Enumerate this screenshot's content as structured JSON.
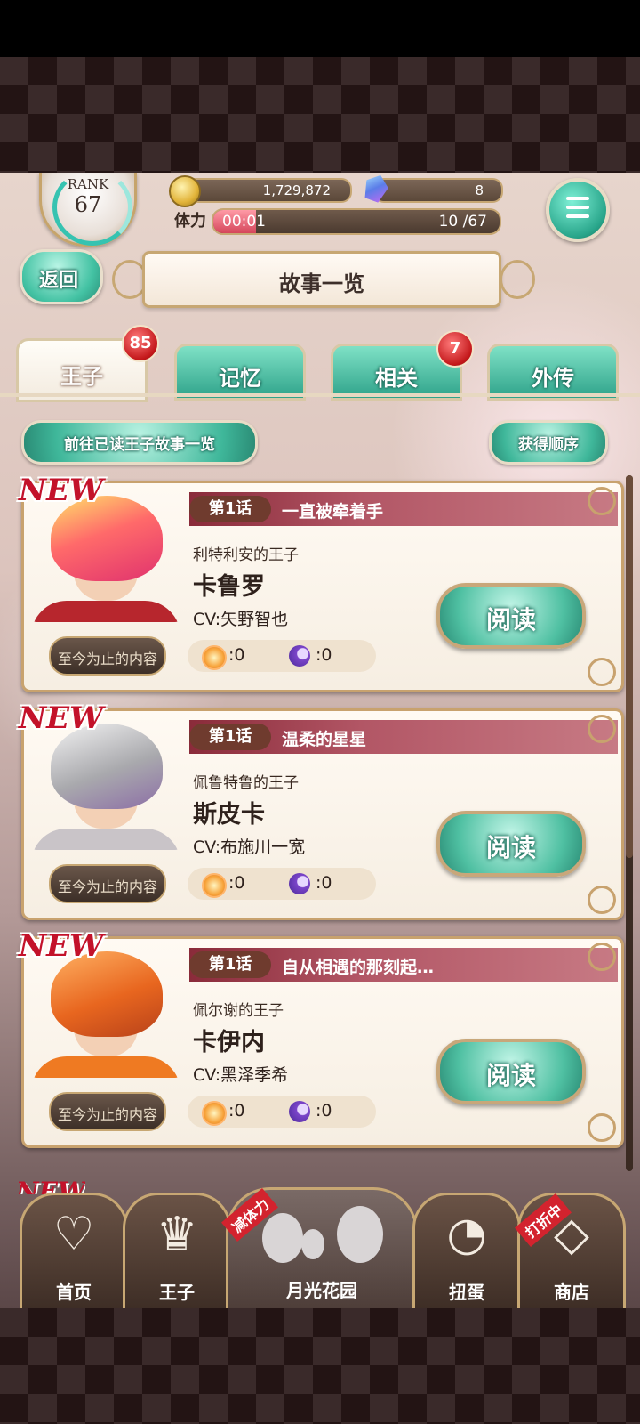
{
  "header": {
    "rank_label": "RANK",
    "rank_value": "67",
    "coins": "1,729,872",
    "gems": "8",
    "stamina_label": "体力",
    "stamina_timer": "00:01",
    "stamina_count": "10 /67",
    "stamina_fraction": 0.15,
    "menu_icon": "hamburger-icon"
  },
  "nav": {
    "back_label": "返回",
    "page_title": "故事一览"
  },
  "tabs": [
    {
      "label": "王子",
      "badge": "85",
      "active": true
    },
    {
      "label": "记忆",
      "badge": "",
      "active": false
    },
    {
      "label": "相关",
      "badge": "7",
      "active": false
    },
    {
      "label": "外传",
      "badge": "",
      "active": false
    }
  ],
  "actions": {
    "read_list_label": "前往已读王子故事一览",
    "sort_label": "获得顺序"
  },
  "stories": [
    {
      "new_tag": "NEW",
      "chapter": "第1话",
      "title": "一直被牵着手",
      "kingdom": "利特利安的王子",
      "name": "卡鲁罗",
      "cv": "CV:矢野智也",
      "progress_label": "至今为止的内容",
      "sun": ":0",
      "moon": ":0",
      "read_label": "阅读"
    },
    {
      "new_tag": "NEW",
      "chapter": "第1话",
      "title": "温柔的星星",
      "kingdom": "佩鲁特鲁的王子",
      "name": "斯皮卡",
      "cv": "CV:布施川一宽",
      "progress_label": "至今为止的内容",
      "sun": ":0",
      "moon": ":0",
      "read_label": "阅读"
    },
    {
      "new_tag": "NEW",
      "chapter": "第1话",
      "title": "自从相遇的那刻起…",
      "kingdom": "佩尔谢的王子",
      "name": "卡伊内",
      "cv": "CV:黑泽季希",
      "progress_label": "至今为止的内容",
      "sun": ":0",
      "moon": ":0",
      "read_label": "阅读"
    }
  ],
  "peek_new": "NEW",
  "bottom_nav": {
    "home": {
      "label": "首页",
      "icon": "heart-icon"
    },
    "prince": {
      "label": "王子",
      "icon": "crown-icon"
    },
    "garden": {
      "label": "月光花园",
      "ribbon": "减体力"
    },
    "gacha": {
      "label": "扭蛋",
      "icon": "capsule-icon"
    },
    "shop": {
      "label": "商店",
      "icon": "diamond-icon",
      "ribbon": "打折中"
    }
  },
  "colors": {
    "accent_teal": "#3fb79a",
    "badge_red": "#c3171a",
    "gold_border": "#c7a773",
    "new_red": "#c3122a"
  }
}
